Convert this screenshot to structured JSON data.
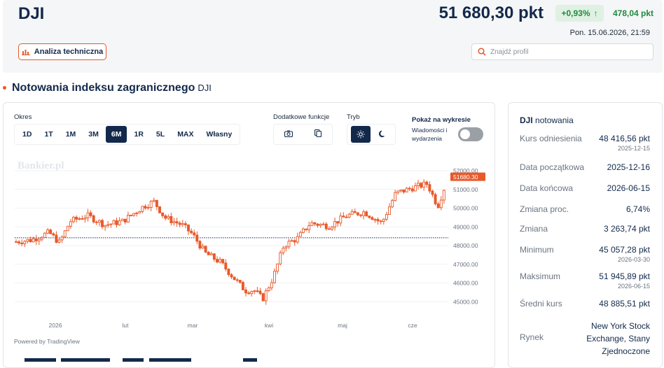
{
  "header": {
    "ticker": "DJI",
    "price": "51 680,30 pkt",
    "change_pct": "+0,93%",
    "change_abs": "478,04 pkt",
    "timestamp": "Pon. 15.06.2026, 21:59",
    "ta_button": "Analiza techniczna",
    "search_placeholder": "Znajdź profil"
  },
  "section": {
    "title": "Notowania indeksu zagranicznego",
    "ticker": "DJI"
  },
  "controls": {
    "period_label": "Okres",
    "periods": [
      "1D",
      "1T",
      "1M",
      "3M",
      "6M",
      "1R",
      "5L",
      "MAX",
      "Własny"
    ],
    "active_period": "6M",
    "functions_label": "Dodatkowe funkcje",
    "mode_label": "Tryb",
    "show_label": "Pokaż na wykresie",
    "show_sub": "Wiadomości i wydarzenia",
    "show_toggle_on": false
  },
  "chart": {
    "watermark": "Bankier.pl",
    "powered_by": "Powered by TradingView",
    "y_ticks": [
      "52000.00",
      "51000.00",
      "50000.00",
      "49000.00",
      "48000.00",
      "47000.00",
      "46000.00",
      "45000.00"
    ],
    "x_ticks": [
      "2026",
      "lut",
      "mar",
      "kwi",
      "maj",
      "cze"
    ],
    "last_label": "51680.30"
  },
  "chart_data": {
    "type": "candlestick",
    "x": [
      "2025-12",
      "2026-01",
      "2026-02",
      "2026-03",
      "2026-04",
      "2026-05",
      "2026-06"
    ],
    "close_approx": [
      48200,
      49250,
      50100,
      45300,
      48700,
      49800,
      51680.3
    ],
    "last": 51680.3,
    "reference_line": 48416.56,
    "ylim": [
      44600,
      52300
    ],
    "colors": {
      "up": "#e8592b",
      "down": "#e8592b",
      "hollow_up": true
    }
  },
  "info": {
    "title_ticker": "DJI",
    "title_suffix": "notowania",
    "rows": [
      {
        "k": "Kurs odniesienia",
        "v": "48 416,56 pkt",
        "d": "2025-12-15"
      },
      {
        "k": "Data początkowa",
        "v": "2025-12-16",
        "d": ""
      },
      {
        "k": "Data końcowa",
        "v": "2026-06-15",
        "d": ""
      },
      {
        "k": "Zmiana proc.",
        "v": "6,74%",
        "d": ""
      },
      {
        "k": "Zmiana",
        "v": "3 263,74 pkt",
        "d": ""
      },
      {
        "k": "Minimum",
        "v": "45 057,28 pkt",
        "d": "2026-03-30"
      },
      {
        "k": "Maksimum",
        "v": "51 945,89 pkt",
        "d": "2026-06-15"
      },
      {
        "k": "Średni kurs",
        "v": "48 885,51 pkt",
        "d": ""
      },
      {
        "k": "Rynek",
        "v": "New York Stock Exchange, Stany Zjednoczone",
        "d": ""
      }
    ]
  }
}
